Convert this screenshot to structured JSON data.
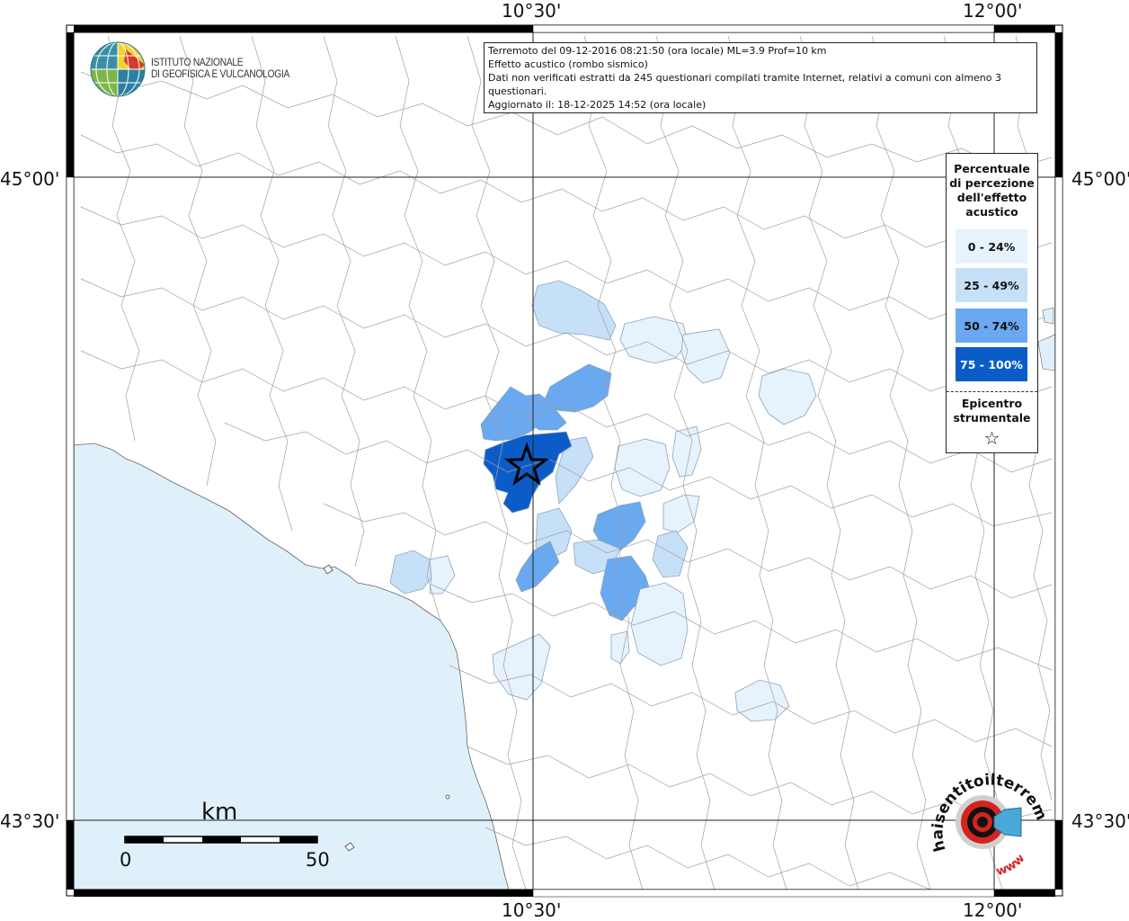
{
  "axes": {
    "lon_labels": [
      "10°30'",
      "12°00'"
    ],
    "lat_labels": [
      "45°00'",
      "43°30'"
    ]
  },
  "info": {
    "line1": "Terremoto del 09-12-2016 08:21:50 (ora locale) ML=3.9 Prof=10 km",
    "line2": "Effetto acustico (rombo sismico)",
    "line3": "Dati non verificati estratti da 245 questionari compilati tramite Internet, relativi a comuni con almeno 3 questionari.",
    "line4": "Aggiornato il: 18-12-2025 14:52 (ora locale)"
  },
  "logo": {
    "line1": "ISTITUTO NAZIONALE",
    "line2": "DI GEOFISICA E VULCANOLOGIA"
  },
  "legend": {
    "title_lines": [
      "Percentuale",
      "di percezione",
      "dell'effetto",
      "acustico"
    ],
    "classes": [
      {
        "label": "0 - 24%",
        "color": "#e6f2fc",
        "text_color": "#111111"
      },
      {
        "label": "25 - 49%",
        "color": "#c6e0f8",
        "text_color": "#111111"
      },
      {
        "label": "50 - 74%",
        "color": "#6aa8f0",
        "text_color": "#111111"
      },
      {
        "label": "75 - 100%",
        "color": "#0c5cc8",
        "text_color": "#ffffff"
      }
    ],
    "epicenter_line1": "Epicentro",
    "epicenter_line2": "strumentale",
    "epicenter_symbol": "☆"
  },
  "scalebar": {
    "unit": "km",
    "start": "0",
    "end": "50"
  },
  "colors": {
    "sea": "#dff0fb",
    "land": "#ffffff",
    "boundary": "#9a9a9a",
    "graticule": "#222222",
    "frame": "#000000"
  },
  "badge": {
    "text_top": "haisentitoilterremoto.it",
    "text_bottom": "www"
  },
  "municipalities": [
    {
      "id": "epicenter-area",
      "class": 3
    },
    {
      "id": "north-west-1",
      "class": 2
    },
    {
      "id": "north-west-2",
      "class": 2
    },
    {
      "id": "north-west-3",
      "class": 2
    },
    {
      "id": "south-east-1",
      "class": 2
    },
    {
      "id": "south-east-2",
      "class": 2
    },
    {
      "id": "south-mid",
      "class": 2
    },
    {
      "id": "north-top",
      "class": 1
    },
    {
      "id": "west-coast",
      "class": 1
    },
    {
      "id": "center-east",
      "class": 1
    },
    {
      "id": "east-1",
      "class": 1
    },
    {
      "id": "south-1",
      "class": 1
    },
    {
      "id": "far-east-1",
      "class": 0
    },
    {
      "id": "far-east-2",
      "class": 0
    },
    {
      "id": "center-east-2",
      "class": 0
    },
    {
      "id": "east-2",
      "class": 0
    },
    {
      "id": "south-2",
      "class": 0
    },
    {
      "id": "south-west-1",
      "class": 0
    },
    {
      "id": "south-east-3",
      "class": 0
    },
    {
      "id": "east-3",
      "class": 0
    }
  ]
}
